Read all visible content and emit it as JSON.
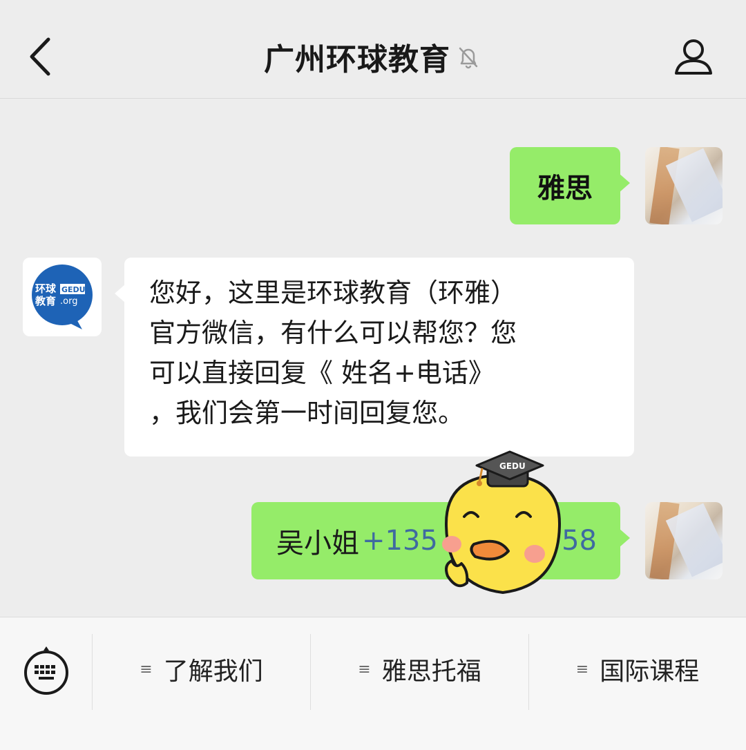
{
  "header": {
    "title": "广州环球教育",
    "back_icon": "chevron-left-icon",
    "mute_icon": "bell-muted-icon",
    "profile_icon": "person-icon"
  },
  "messages": [
    {
      "from": "self",
      "text": "雅思"
    },
    {
      "from": "official",
      "text": "您好，这里是环球教育（环雅）官方微信，有什么可以帮您？您可以直接回复《 姓名+电话》，我们会第一时间回复您。",
      "lines": [
        "您好，这里是环球教育（环雅）",
        "官方微信，有什么可以帮您？您",
        "可以直接回复《 姓名+电话》",
        "，我们会第一时间回复您。"
      ]
    },
    {
      "from": "self",
      "name": "吴小姐",
      "phone_visible": "+135",
      "phone_tail": "58"
    }
  ],
  "brand_avatar": {
    "line1": "环球",
    "badge": "GEDU",
    "line2": "教育",
    "domain": ".org"
  },
  "sticker": {
    "hat_text": "GEDU"
  },
  "menu": {
    "keyboard_icon": "keyboard-icon",
    "items": [
      {
        "label": "了解我们",
        "icon": "menu-lines-icon"
      },
      {
        "label": "雅思托福",
        "icon": "menu-lines-icon"
      },
      {
        "label": "国际课程",
        "icon": "menu-lines-icon"
      }
    ]
  },
  "colors": {
    "background": "#ededed",
    "self_bubble": "#95ec69",
    "official_bubble": "#ffffff",
    "brand_blue": "#1e63b6",
    "phone_link": "#3f6aa0"
  }
}
